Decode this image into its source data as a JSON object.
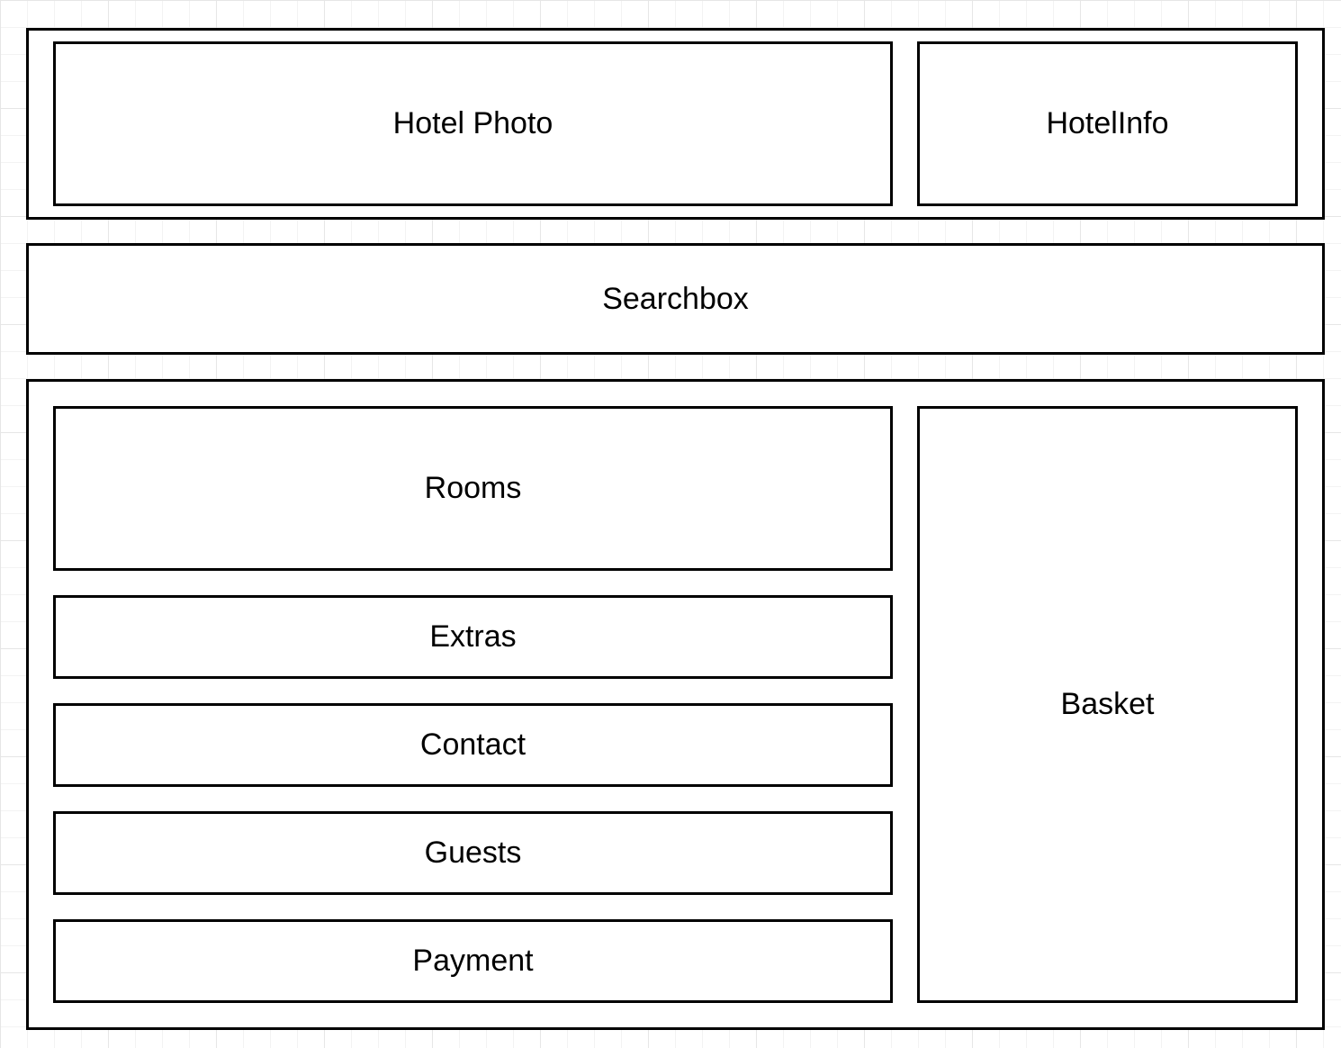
{
  "header": {
    "hotel_photo": "Hotel Photo",
    "hotel_info": "HotelInfo"
  },
  "search": {
    "label": "Searchbox"
  },
  "main": {
    "sections": {
      "rooms": "Rooms",
      "extras": "Extras",
      "contact": "Contact",
      "guests": "Guests",
      "payment": "Payment"
    },
    "basket": "Basket"
  },
  "colors": {
    "border": "#000000",
    "background": "#ffffff",
    "grid": "#e6e6e6"
  }
}
